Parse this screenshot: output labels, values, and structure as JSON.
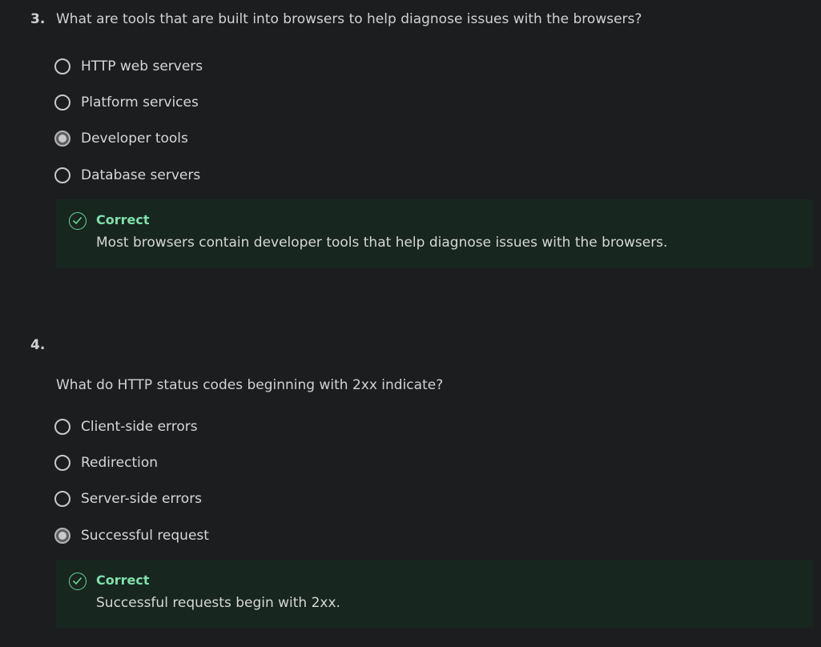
{
  "questions": [
    {
      "number": "3.",
      "text": "What are tools that are built into browsers to help diagnose issues with the browsers?",
      "options": [
        "HTTP web servers",
        "Platform services",
        "Developer tools",
        "Database servers"
      ],
      "selected": "Developer tools",
      "feedback": {
        "title": "Correct",
        "text": "Most browsers contain developer tools that help diagnose issues with the browsers."
      }
    },
    {
      "number": "4.",
      "text": "What do HTTP status codes beginning with 2xx indicate?",
      "options": [
        "Client-side errors",
        "Redirection",
        "Server-side errors",
        "Successful request"
      ],
      "selected": "Successful request",
      "feedback": {
        "title": "Correct",
        "text": "Successful requests begin with 2xx."
      }
    }
  ],
  "icons": {
    "feedback": "check-circle-icon",
    "option": "radio-icon"
  },
  "colors": {
    "background": "#1c1d1f",
    "feedback_bg": "#17261f",
    "correct": "#7fe0ab"
  }
}
